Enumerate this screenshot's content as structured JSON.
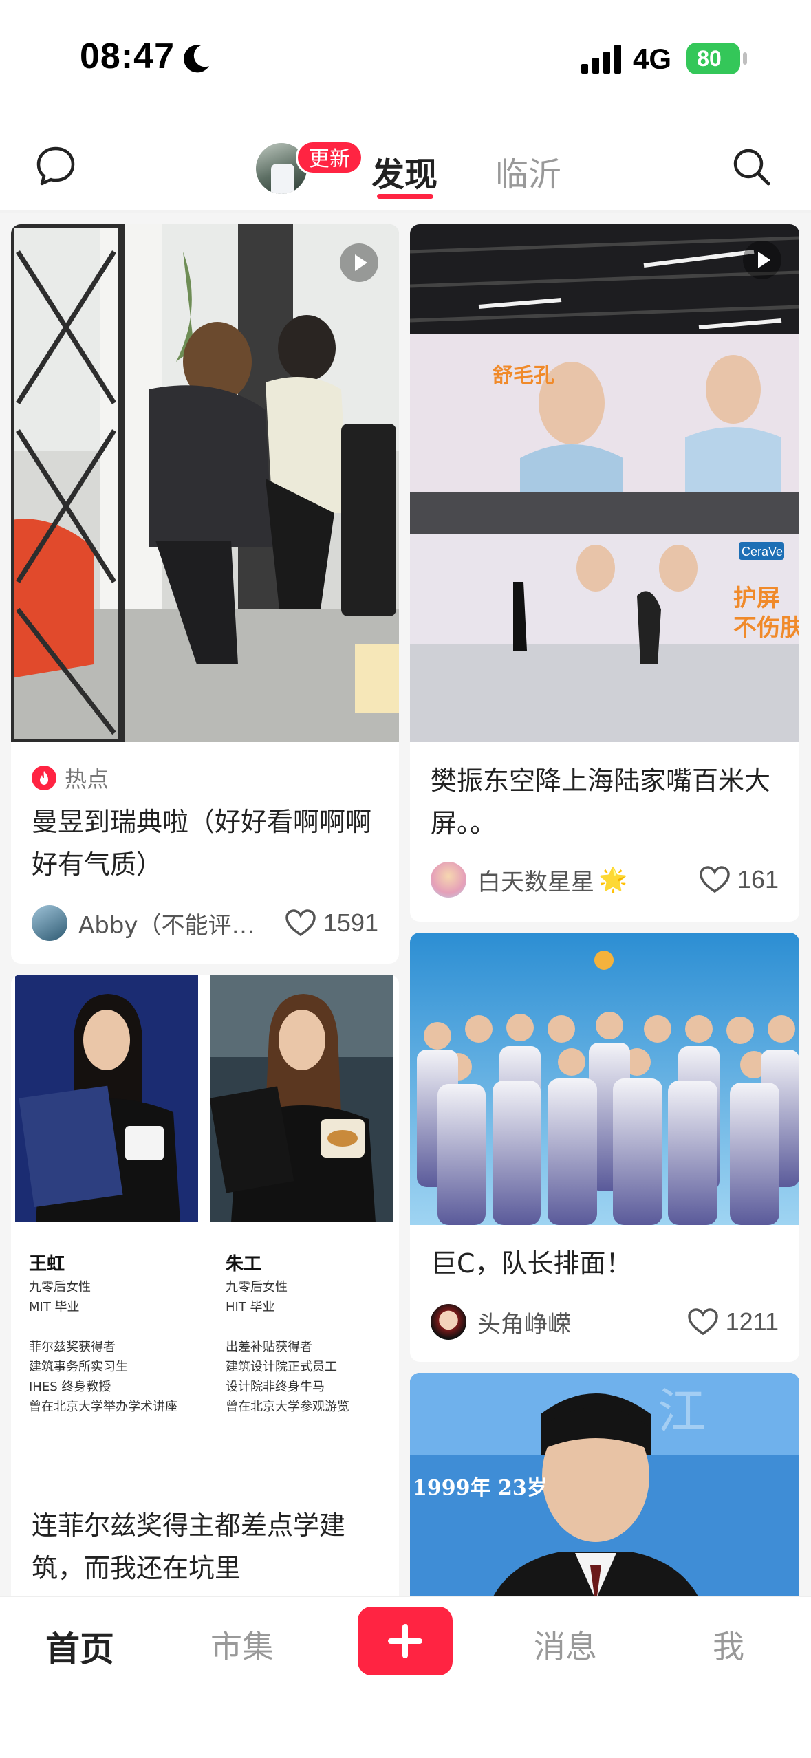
{
  "status_bar": {
    "time": "08:47",
    "network": "4G",
    "battery": "80"
  },
  "top_nav": {
    "update_badge": "更新",
    "tabs": [
      {
        "label": "发现",
        "active": true
      },
      {
        "label": "临沂",
        "active": false
      }
    ]
  },
  "feed": {
    "cards": [
      {
        "tag": "热点",
        "title": "曼昱到瑞典啦（好好看啊啊啊好有气质）",
        "author": "Abby（不能评…",
        "likes": "1591",
        "is_video": true
      },
      {
        "title": "樊振东空降上海陆家嘴百米大屏。。",
        "author": "白天数星星",
        "author_emoji": "🌟",
        "likes": "161",
        "is_video": true,
        "image_text": {
          "brand": "CeraVe",
          "sign1": "护屏",
          "sign2": "不伤肤"
        }
      },
      {
        "title": "连菲尔兹奖得主都差点学建筑，而我还在坑里",
        "image_text": {
          "left": {
            "name": "王虹",
            "lines": [
              "九零后女性",
              "MIT 毕业",
              "",
              "菲尔兹奖获得者",
              "建筑事务所实习生",
              "IHES 终身教授",
              "曾在北京大学举办学术讲座"
            ]
          },
          "right": {
            "name": "朱工",
            "lines": [
              "九零后女性",
              "HIT 毕业",
              "",
              "出差补贴获得者",
              "建筑设计院正式员工",
              "设计院非终身牛马",
              "曾在北京大学参观游览"
            ]
          }
        }
      },
      {
        "title": "巨C，队长排面！",
        "author": "头角峥嵘",
        "likes": "1211"
      },
      {
        "image_caption": "1999年 23岁"
      }
    ]
  },
  "bottom_bar": {
    "items": [
      {
        "label": "首页",
        "active": true
      },
      {
        "label": "市集",
        "active": false
      },
      {
        "label": "消息",
        "active": false
      },
      {
        "label": "我",
        "active": false
      }
    ]
  },
  "colors": {
    "accent": "#ff2442",
    "battery": "#34c759"
  }
}
